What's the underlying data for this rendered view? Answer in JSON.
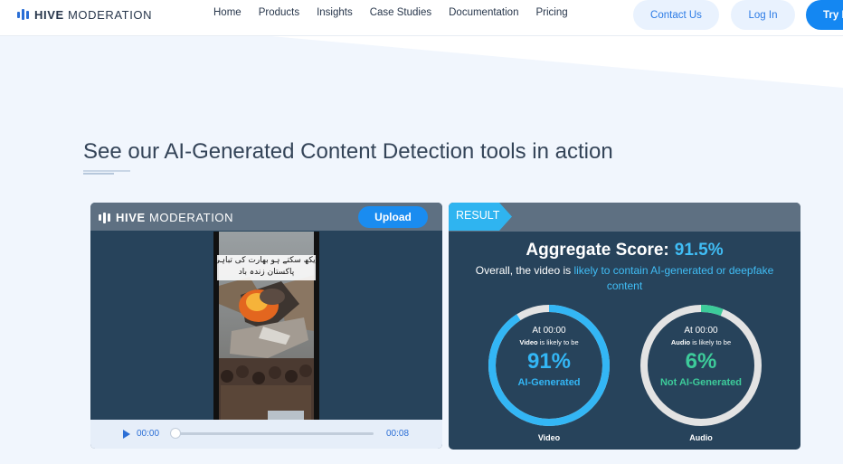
{
  "nav": {
    "brand_bold": "HIVE",
    "brand_rest": "MODERATION",
    "links": [
      "Home",
      "Products",
      "Insights",
      "Case Studies",
      "Documentation",
      "Pricing"
    ],
    "contact_label": "Contact Us",
    "login_label": "Log In",
    "try_label": "Try I"
  },
  "section": {
    "heading": "See our AI-Generated Content Detection tools in action"
  },
  "demo": {
    "brand_bold": "HIVE",
    "brand_rest": "MODERATION",
    "upload_label": "Upload",
    "video_caption_line1": "دیکھ سکتے ہو بھارت کی تباہی",
    "video_caption_line2": "پاکستان زندہ باد",
    "current_time": "00:00",
    "duration": "00:08",
    "progress": 0
  },
  "result": {
    "tag": "RESULT",
    "aggregate_label": "Aggregate Score:",
    "aggregate_value": "91.5%",
    "overall_prefix": "Overall, the video is ",
    "overall_highlight": "likely to contain AI-generated or deepfake content",
    "video": {
      "at": "At 00:00",
      "subject": "Video",
      "likely": " is likely to be",
      "percent": "91%",
      "percent_value": 0.91,
      "classification": "AI-Generated",
      "caption": "Video",
      "color": "#33b6f5"
    },
    "audio": {
      "at": "At 00:00",
      "subject": "Audio",
      "likely": " is likely to be",
      "percent": "6%",
      "percent_value": 0.06,
      "classification": "Not AI-Generated",
      "caption": "Audio",
      "color": "#3dcb9a"
    }
  },
  "colors": {
    "accent": "#1487f2",
    "card_bg": "#27435b",
    "card_header": "#5e7082",
    "highlight_blue": "#40bdf5",
    "highlight_green": "#3dcb9a"
  }
}
